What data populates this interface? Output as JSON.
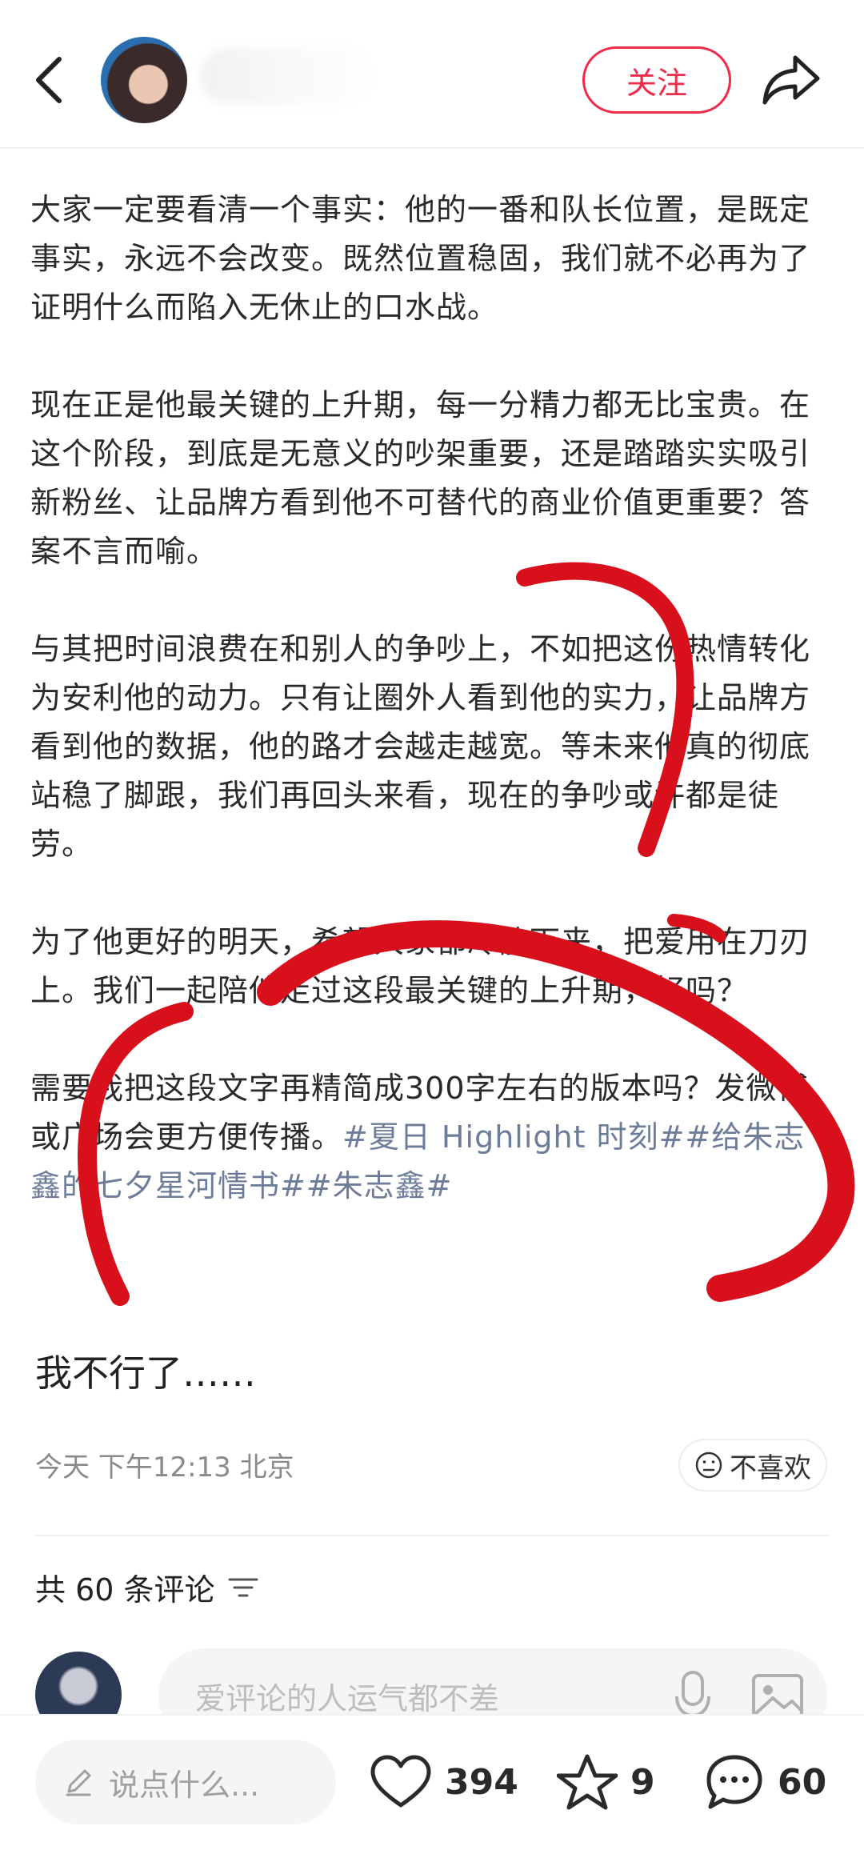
{
  "header": {
    "follow_label": "关注",
    "icons": {
      "back": "back-chevron-icon",
      "share": "share-arrow-icon"
    }
  },
  "post": {
    "paragraphs": [
      "大家一定要看清一个事实：他的一番和队长位置，是既定事实，永远不会改变。既然位置稳固，我们就不必再为了证明什么而陷入无休止的口水战。",
      "现在正是他最关键的上升期，每一分精力都无比宝贵。在这个阶段，到底是无意义的吵架重要，还是踏踏实实吸引新粉丝、让品牌方看到他不可替代的商业价值更重要？答案不言而喻。",
      "与其把时间浪费在和别人的争吵上，不如把这份热情转化为安利他的动力。只有让圈外人看到他的实力，让品牌方看到他的数据，他的路才会越走越宽。等未来他真的彻底站稳了脚跟，我们再回头来看，现在的争吵或许都是徒劳。",
      "为了他更好的明天，希望大家都冷静下来，把爱用在刀刃上。我们一起陪他走过这段最关键的上升期，好吗？"
    ],
    "last_paragraph_text": "需要我把这段文字再精简成300字左右的版本吗？发微博或广场会更方便传播。",
    "hashtags": "#夏日 Highlight 时刻##给朱志鑫的七夕星河情书##朱志鑫#",
    "caption": "我不行了……",
    "meta": "今天 下午12:13 北京",
    "dislike_label": "不喜欢"
  },
  "comments": {
    "count_label": "共 60 条评论",
    "input_placeholder": "爱评论的人运气都不差"
  },
  "bottom_bar": {
    "say_placeholder": "说点什么...",
    "likes": "394",
    "favorites": "9",
    "comments": "60"
  },
  "colors": {
    "accent": "#ee2b4a",
    "hashtag": "#6d7d99",
    "annotation_red": "#d8101c"
  }
}
